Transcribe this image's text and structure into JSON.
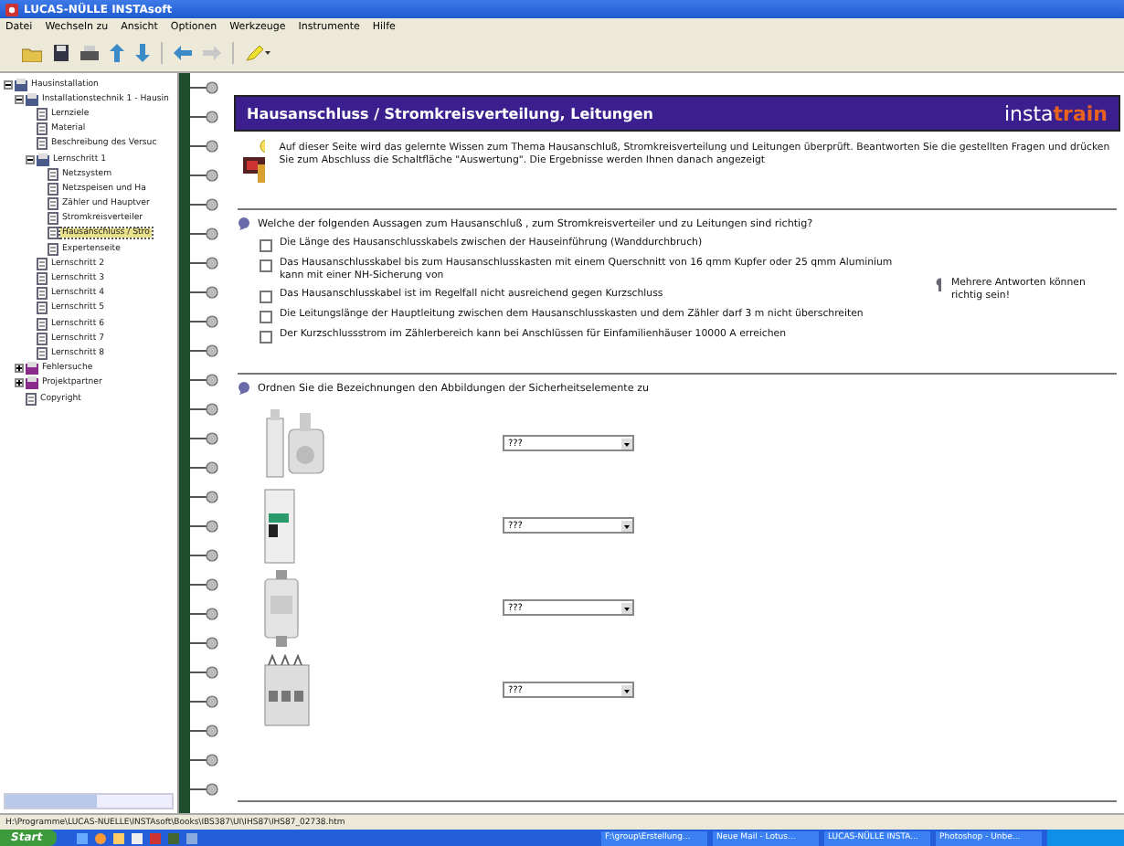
{
  "window": {
    "title": "LUCAS-NÜLLE INSTAsoft"
  },
  "menu": [
    "Datei",
    "Wechseln zu",
    "Ansicht",
    "Optionen",
    "Werkzeuge",
    "Instrumente",
    "Hilfe"
  ],
  "tree": [
    {
      "label": "Hausinstallation",
      "expanded": true,
      "selected": false,
      "children": [
        {
          "label": "Installationstechnik 1 - Hausin",
          "expanded": true,
          "selected": false,
          "children": [
            {
              "label": "Lernziele",
              "selected": false
            },
            {
              "label": "Material",
              "selected": false
            },
            {
              "label": "Beschreibung des Versuc",
              "selected": false
            },
            {
              "label": "Lernschritt 1",
              "expanded": true,
              "selected": false,
              "children": [
                {
                  "label": "Netzsystem",
                  "selected": false
                },
                {
                  "label": "Netzspeisen und Ha",
                  "selected": false
                },
                {
                  "label": "Zähler und Hauptver",
                  "selected": false
                },
                {
                  "label": "Stromkreisverteiler",
                  "selected": false
                },
                {
                  "label": "Hausanschluss / Stro",
                  "selected": true
                },
                {
                  "label": "Expertenseite",
                  "selected": false
                }
              ]
            },
            {
              "label": "Lernschritt 2",
              "selected": false
            },
            {
              "label": "Lernschritt 3",
              "selected": false
            },
            {
              "label": "Lernschritt 4",
              "selected": false
            },
            {
              "label": "Lernschritt 5",
              "selected": false
            },
            {
              "label": "Lernschritt 6",
              "selected": false
            },
            {
              "label": "Lernschritt 7",
              "selected": false
            },
            {
              "label": "Lernschritt 8",
              "selected": false
            }
          ]
        },
        {
          "label": "Fehlersuche",
          "expanded": false,
          "selected": false
        },
        {
          "label": "Projektpartner",
          "expanded": false,
          "selected": false
        },
        {
          "label": "Copyright",
          "selected": false
        }
      ]
    }
  ],
  "page": {
    "title": "Hausanschluss / Stromkreisverteilung, Leitungen",
    "logo_light": "insta",
    "logo_bold": "train",
    "intro": "Auf dieser Seite wird das gelernte Wissen zum Thema Hausanschluß, Stromkreisverteilung und Leitungen überprüft. Beantworten Sie die gestellten Fragen und drücken Sie zum Abschluss die Schaltfläche \"Auswertung\". Die Ergebnisse werden Ihnen danach angezeigt",
    "question_1": {
      "text": "Welche der folgenden Aussagen zum Hausanschluß , zum Stromkreisverteiler und zu Leitungen sind richtig?",
      "options": [
        {
          "text": "Die Länge des Hausanschlusskabels zwischen der Hauseinführung (Wanddurchbruch)",
          "checked": false
        },
        {
          "text": "Das Hausanschlusskabel bis zum Hausanschlusskasten mit einem Querschnitt von 16 qmm Kupfer oder 25 qmm Aluminium kann mit einer NH-Sicherung von",
          "checked": false
        },
        {
          "text": "Das Hausanschlusskabel ist im Regelfall nicht ausreichend gegen Kurzschluss",
          "checked": false
        },
        {
          "text": "Die Leitungslänge der Hauptleitung zwischen dem Hausanschlusskasten und dem Zähler darf 3 m nicht überschreiten",
          "checked": false
        },
        {
          "text": "Der Kurzschlussstrom im Zählerbereich kann bei Anschlüssen für Einfamilienhäuser 10000 A erreichen",
          "checked": false
        }
      ],
      "hint": "Mehrere Antworten können richtig sein!"
    },
    "question_2": {
      "text": "Ordnen Sie die Bezeichnungen den Abbildungen der Sicherheitselemente zu",
      "items": [
        {
          "kind": "fuse-set",
          "value": "???"
        },
        {
          "kind": "breaker",
          "value": "???"
        },
        {
          "kind": "nh-fuse",
          "value": "???"
        },
        {
          "kind": "multi-breaker",
          "value": "???"
        }
      ]
    }
  },
  "status_bar": "H:\\Programme\\LUCAS-NUELLE\\INSTAsoft\\Books\\IBS387\\UI\\IHS87\\IHS87_02738.htm",
  "taskbar": {
    "start": "Start",
    "tasks": [
      "F:\\group\\Erstellung...",
      "Neue Mail - Lotus...",
      "LUCAS-NÜLLE INSTA...",
      "Photoshop - Unbe..."
    ]
  }
}
